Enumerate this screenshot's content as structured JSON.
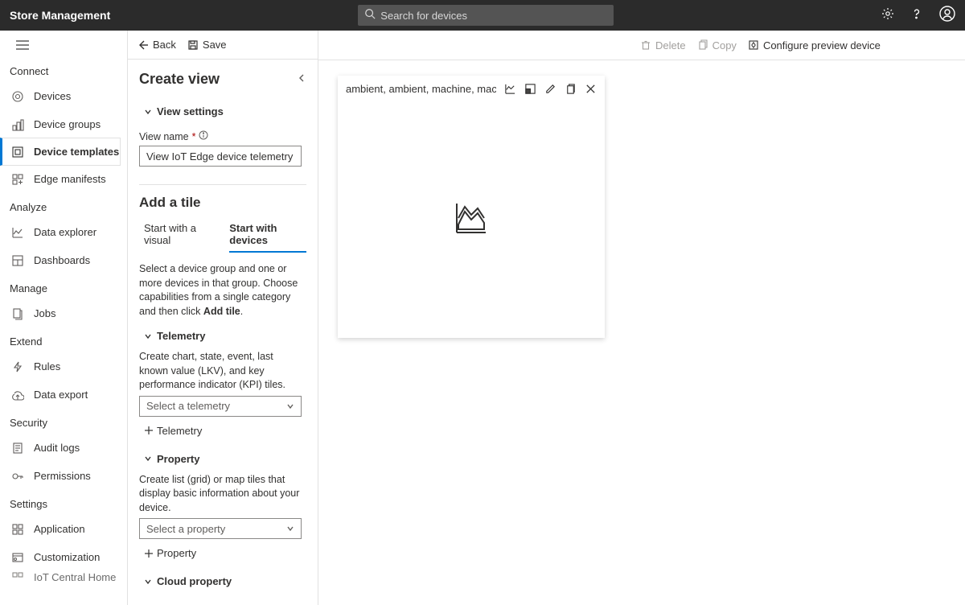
{
  "header": {
    "title": "Store Management",
    "search_placeholder": "Search for devices"
  },
  "sidebar": {
    "sections": [
      {
        "title": "Connect",
        "items": [
          {
            "label": "Devices",
            "icon": "connect"
          },
          {
            "label": "Device groups",
            "icon": "group"
          },
          {
            "label": "Device templates",
            "icon": "template",
            "active": true
          },
          {
            "label": "Edge manifests",
            "icon": "edge"
          }
        ]
      },
      {
        "title": "Analyze",
        "items": [
          {
            "label": "Data explorer",
            "icon": "chart"
          },
          {
            "label": "Dashboards",
            "icon": "grid"
          }
        ]
      },
      {
        "title": "Manage",
        "items": [
          {
            "label": "Jobs",
            "icon": "jobs"
          }
        ]
      },
      {
        "title": "Extend",
        "items": [
          {
            "label": "Rules",
            "icon": "rules"
          },
          {
            "label": "Data export",
            "icon": "export"
          }
        ]
      },
      {
        "title": "Security",
        "items": [
          {
            "label": "Audit logs",
            "icon": "audit"
          },
          {
            "label": "Permissions",
            "icon": "key"
          }
        ]
      },
      {
        "title": "Settings",
        "items": [
          {
            "label": "Application",
            "icon": "app"
          },
          {
            "label": "Customization",
            "icon": "custom"
          },
          {
            "label": "IoT Central Home",
            "icon": "home",
            "cutoff": true
          }
        ]
      }
    ]
  },
  "toolbar": {
    "back": "Back",
    "save": "Save",
    "delete": "Delete",
    "copy": "Copy",
    "configure": "Configure preview device"
  },
  "panel": {
    "title": "Create view",
    "view_settings_label": "View settings",
    "view_name_label": "View name",
    "view_name_value": "View IoT Edge device telemetry",
    "add_tile_title": "Add a tile",
    "tabs": {
      "visual": "Start with a visual",
      "devices": "Start with devices"
    },
    "devices_help_1": "Select a device group and one or more devices in that group. Choose capabilities from a single category and then click ",
    "devices_help_2": "Add tile",
    "devices_help_3": ".",
    "telemetry": {
      "header": "Telemetry",
      "help": "Create chart, state, event, last known value (LKV), and key performance indicator (KPI) tiles.",
      "placeholder": "Select a telemetry",
      "add": "Telemetry"
    },
    "property": {
      "header": "Property",
      "help": "Create list (grid) or map tiles that display basic information about your device.",
      "placeholder": "Select a property",
      "add": "Property"
    },
    "cloud_property": {
      "header": "Cloud property"
    }
  },
  "tile": {
    "title": "ambient, ambient, machine, macl"
  }
}
